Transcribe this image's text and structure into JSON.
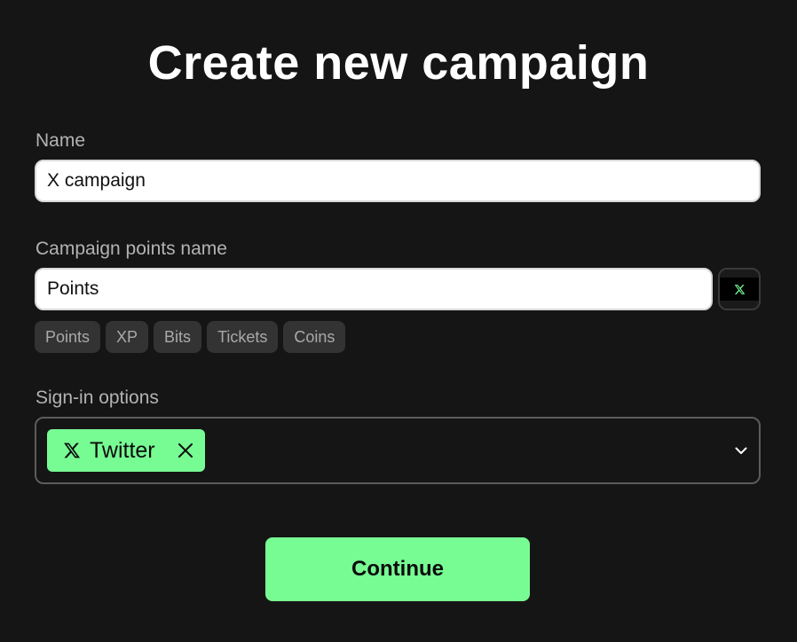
{
  "page": {
    "title": "Create new campaign"
  },
  "name_field": {
    "label": "Name",
    "value": "X campaign"
  },
  "points_field": {
    "label": "Campaign points name",
    "value": "Points",
    "icon": "x-logo-icon",
    "suggestions": [
      "Points",
      "XP",
      "Bits",
      "Tickets",
      "Coins"
    ]
  },
  "signin_field": {
    "label": "Sign-in options",
    "selected": [
      {
        "label": "Twitter",
        "icon": "x-logo-icon"
      }
    ]
  },
  "actions": {
    "continue_label": "Continue"
  },
  "colors": {
    "background": "#151515",
    "accent": "#77fc93",
    "chip_bg": "#333333",
    "label": "#b3b3b3"
  }
}
